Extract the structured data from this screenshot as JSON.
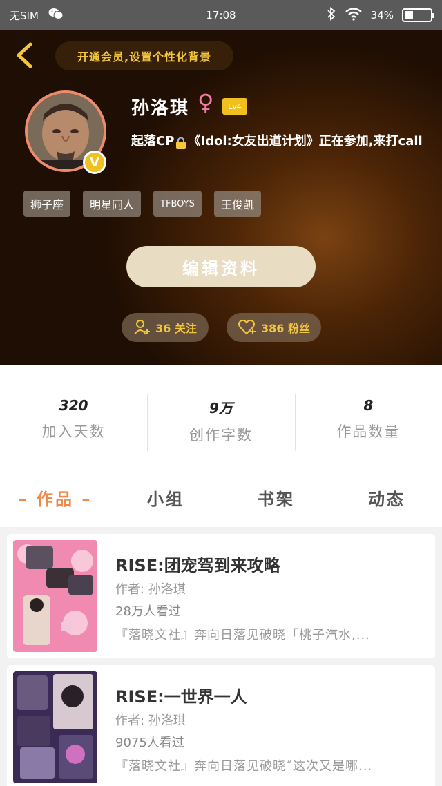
{
  "status_bar": {
    "carrier": "无SIM",
    "time": "17:08",
    "battery": "34%",
    "battery_level": 0.34
  },
  "header": {
    "vip_banner": "开通会员,设置个性化背景"
  },
  "profile": {
    "name": "孙洛琪",
    "gender_symbol": "♀",
    "level": "Lv4",
    "v_badge": "V",
    "bio_prefix": "起落CP",
    "bio_suffix": "《Idol:女友出道计划》正在参加,来打call",
    "tags": [
      "狮子座",
      "明星同人",
      "TFBOYS",
      "王俊凯"
    ],
    "edit_label": "编辑资料",
    "following": "36 关注",
    "fans": "386 粉丝"
  },
  "stats": [
    {
      "value": "320",
      "label": "加入天数"
    },
    {
      "value": "9万",
      "label": "创作字数"
    },
    {
      "value": "8",
      "label": "作品数量"
    }
  ],
  "tabs": [
    "– 作品 –",
    "小组",
    "书架",
    "动态"
  ],
  "works": [
    {
      "title": "RISE:团宠驾到来攻略",
      "author": "作者: 孙洛琪",
      "views": "28万人看过",
      "desc": "『落晓文社』奔向日落见破晓「桃子汽水,..."
    },
    {
      "title": "RISE:一世界一人",
      "author": "作者: 孙洛琪",
      "views": "9075人看过",
      "desc": "『落晓文社』奔向日落见破晓˝这次又是哪..."
    }
  ],
  "colors": {
    "accent": "#f08a4b",
    "gold": "#f3c63b",
    "badge": "#f2c01e"
  }
}
